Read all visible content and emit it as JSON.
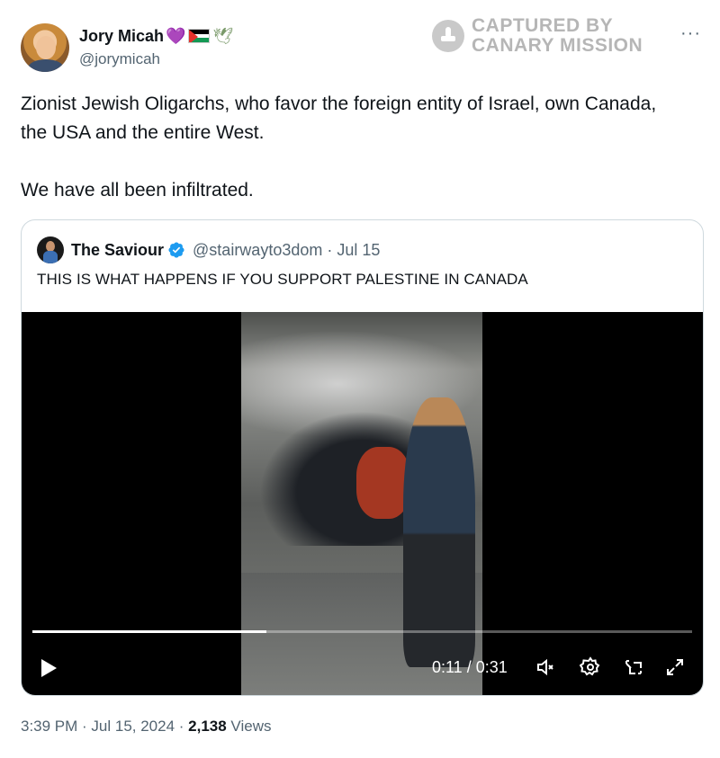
{
  "author": {
    "display_name": "Jory Micah",
    "handle": "@jorymicah",
    "name_emojis": [
      "purple-heart",
      "palestine-flag",
      "dove"
    ]
  },
  "watermark": {
    "line1": "CAPTURED BY",
    "line2": "CANARY MISSION"
  },
  "more_menu": "···",
  "tweet": {
    "paragraph1": "Zionist Jewish Oligarchs, who favor the foreign entity of Israel, own Canada, the USA and the entire West.",
    "paragraph2": "We have all been infiltrated."
  },
  "quoted_tweet": {
    "display_name": "The Saviour",
    "handle_date": "@stairwayto3dom · Jul 15",
    "verified": true,
    "text": "THIS IS WHAT HAPPENS IF YOU SUPPORT PALESTINE IN CANADA"
  },
  "video": {
    "time": "0:11 / 0:31",
    "progress": 0.355,
    "icons": [
      "play-icon",
      "mute-icon",
      "settings-icon",
      "picture-in-picture-icon",
      "fullscreen-icon"
    ]
  },
  "meta": {
    "time_date": "3:39 PM · Jul 15, 2024 · ",
    "views_count": "2,138",
    "views_label": " Views"
  },
  "colors": {
    "text": "#0f1419",
    "secondary": "#536471",
    "border": "#cfd9de",
    "verified": "#1d9bf0"
  }
}
